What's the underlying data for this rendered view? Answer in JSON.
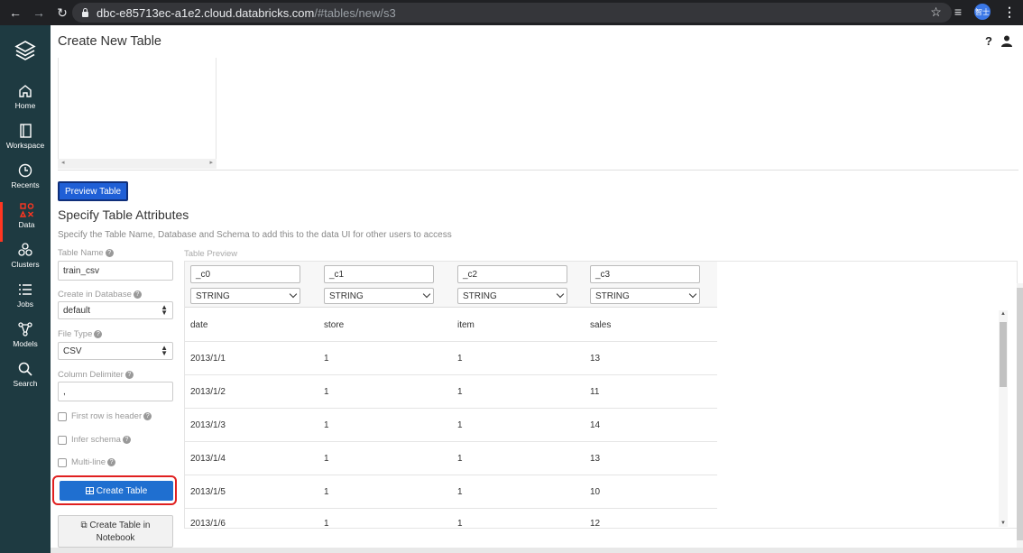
{
  "browser": {
    "url_host": "dbc-e85713ec-a1e2.cloud.databricks.com",
    "url_path": "/#tables/new/s3",
    "profile_initials": "智士"
  },
  "sidebar": {
    "items": [
      {
        "label": "Home",
        "icon": "home-icon"
      },
      {
        "label": "Workspace",
        "icon": "workspace-icon"
      },
      {
        "label": "Recents",
        "icon": "clock-icon"
      },
      {
        "label": "Data",
        "icon": "data-icon",
        "active": true
      },
      {
        "label": "Clusters",
        "icon": "clusters-icon"
      },
      {
        "label": "Jobs",
        "icon": "jobs-icon"
      },
      {
        "label": "Models",
        "icon": "models-icon"
      },
      {
        "label": "Search",
        "icon": "search-icon"
      }
    ],
    "accent": "#ff3621"
  },
  "header": {
    "title": "Create New Table",
    "help": "?"
  },
  "preview_button": "Preview Table",
  "attributes": {
    "title": "Specify Table Attributes",
    "description": "Specify the Table Name, Database and Schema to add this to the data UI for other users to access"
  },
  "form": {
    "table_name_label": "Table Name",
    "table_name_value": "train_csv",
    "database_label": "Create in Database",
    "database_value": "default",
    "file_type_label": "File Type",
    "file_type_value": "CSV",
    "delimiter_label": "Column Delimiter",
    "delimiter_value": ",",
    "first_row_header": "First row is header",
    "infer_schema": "Infer schema",
    "multi_line": "Multi-line",
    "create_button": "Create Table",
    "notebook_button_line1": "Create Table in",
    "notebook_button_line2": "Notebook"
  },
  "preview": {
    "label": "Table Preview",
    "columns": [
      {
        "name": "_c0",
        "type": "STRING"
      },
      {
        "name": "_c1",
        "type": "STRING"
      },
      {
        "name": "_c2",
        "type": "STRING"
      },
      {
        "name": "_c3",
        "type": "STRING"
      }
    ],
    "rows": [
      [
        "date",
        "store",
        "item",
        "sales"
      ],
      [
        "2013/1/1",
        "1",
        "1",
        "13"
      ],
      [
        "2013/1/2",
        "1",
        "1",
        "11"
      ],
      [
        "2013/1/3",
        "1",
        "1",
        "14"
      ],
      [
        "2013/1/4",
        "1",
        "1",
        "13"
      ],
      [
        "2013/1/5",
        "1",
        "1",
        "10"
      ],
      [
        "2013/1/6",
        "1",
        "1",
        "12"
      ]
    ]
  },
  "colors": {
    "primary_button": "#1f6fd0",
    "highlight": "#e02020",
    "sidebar_bg": "#1e3a41"
  }
}
